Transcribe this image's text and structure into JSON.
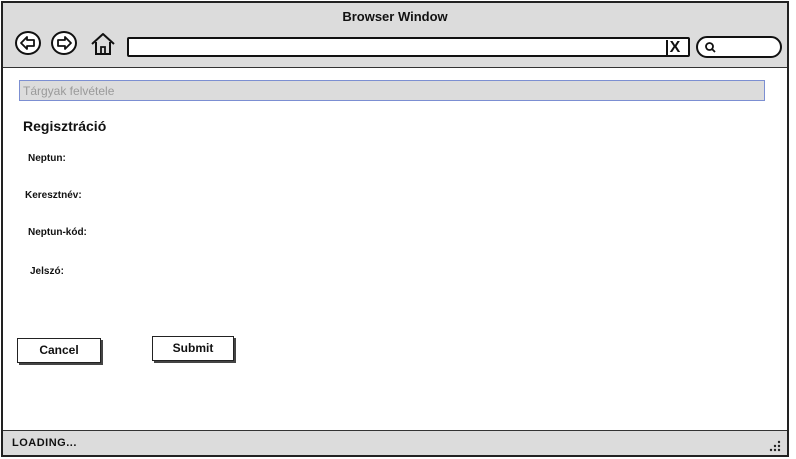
{
  "window": {
    "title": "Browser Window"
  },
  "toolbar": {
    "back_icon": "back-arrow-icon",
    "forward_icon": "forward-arrow-icon",
    "home_icon": "home-icon",
    "url_value": "",
    "clear_label": "X",
    "search_icon": "search-icon"
  },
  "page": {
    "breadcrumb": "Tárgyak felvétele",
    "heading": "Regisztráció",
    "fields": [
      {
        "label": "Neptun:"
      },
      {
        "label": "Keresztnév:"
      },
      {
        "label": "Neptun-kód:"
      },
      {
        "label": "Jelszó:"
      }
    ],
    "buttons": {
      "cancel": "Cancel",
      "submit": "Submit"
    }
  },
  "statusbar": {
    "text": "LOADING..."
  },
  "colors": {
    "chrome": "#dcdcdc",
    "border": "#222222",
    "breadcrumb_border": "#7c8fd2"
  }
}
